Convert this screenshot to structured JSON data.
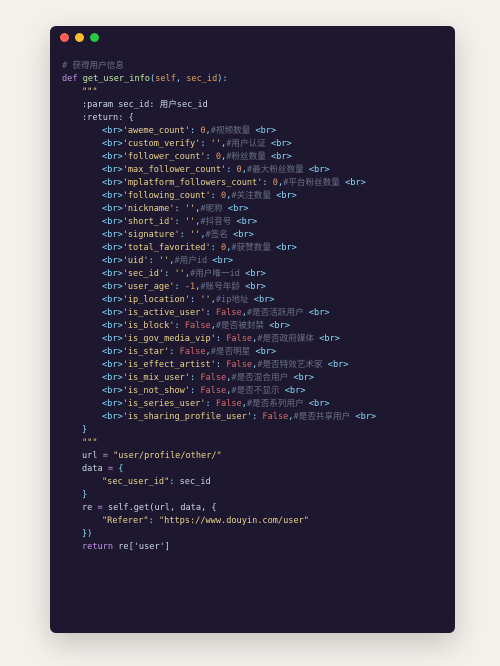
{
  "comment": "# 获得用户信息",
  "def": {
    "kw": "def",
    "name": "get_user_info",
    "params": "(self, sec_id):"
  },
  "doc": {
    "open": "\"\"\"",
    "param": ":param sec_id: 用户sec_id",
    "ret": ":return: {",
    "lines": [
      "<br>'aweme_count': 0,#视频数量 <br>",
      "<br>'custom_verify': '',#用户认证 <br>",
      "<br>'follower_count': 0,#粉丝数量 <br>",
      "<br>'max_follower_count': 0,#最大粉丝数量 <br>",
      "<br>'mplatform_followers_count': 0,#平台粉丝数量 <br>",
      "<br>'following_count': 0,#关注数量 <br>",
      "<br>'nickname': '',#昵称 <br>",
      "<br>'short_id': '',#抖音号 <br>",
      "<br>'signature': '',#签名 <br>",
      "<br>'total_favorited': 0,#获赞数量 <br>",
      "<br>'uid': '',#用户id <br>",
      "<br>'sec_id': '',#用户唯一id <br>",
      "<br>'user_age': -1,#账号年龄 <br>",
      "<br>'ip_location': '',#ip地址 <br>",
      "<br>'is_active_user': False,#是否活跃用户 <br>",
      "<br>'is_block': False,#是否被封禁 <br>",
      "<br>'is_gov_media_vip': False,#是否政府媒体 <br>",
      "<br>'is_star': False,#是否明星 <br>",
      "<br>'is_effect_artist': False,#是否特效艺术家 <br>",
      "<br>'is_mix_user': False,#是否混合用户 <br>",
      "<br>'is_not_show': False,#是否不显示 <br>",
      "<br>'is_series_user': False,#是否系列用户 <br>",
      "<br>'is_sharing_profile_user': False,#是否共享用户 <br>"
    ],
    "close_brace": "}",
    "close": "\"\"\""
  },
  "body": {
    "url_assign_l": "url ",
    "url_assign_r": " \"user/profile/other/\"",
    "data_open": "data = {",
    "data_kv_key": "\"sec_user_id\"",
    "data_kv_sep": ": ",
    "data_kv_val": "sec_id",
    "data_close": "}",
    "re_open_l": "re ",
    "re_open_r": " self.get(url, data, {",
    "referer_key": "\"Referer\"",
    "referer_sep": ": ",
    "referer_val": "\"https://www.douyin.com/user\"",
    "dict_close": "})",
    "return_kw": "return",
    "return_rest": " re['user']"
  }
}
